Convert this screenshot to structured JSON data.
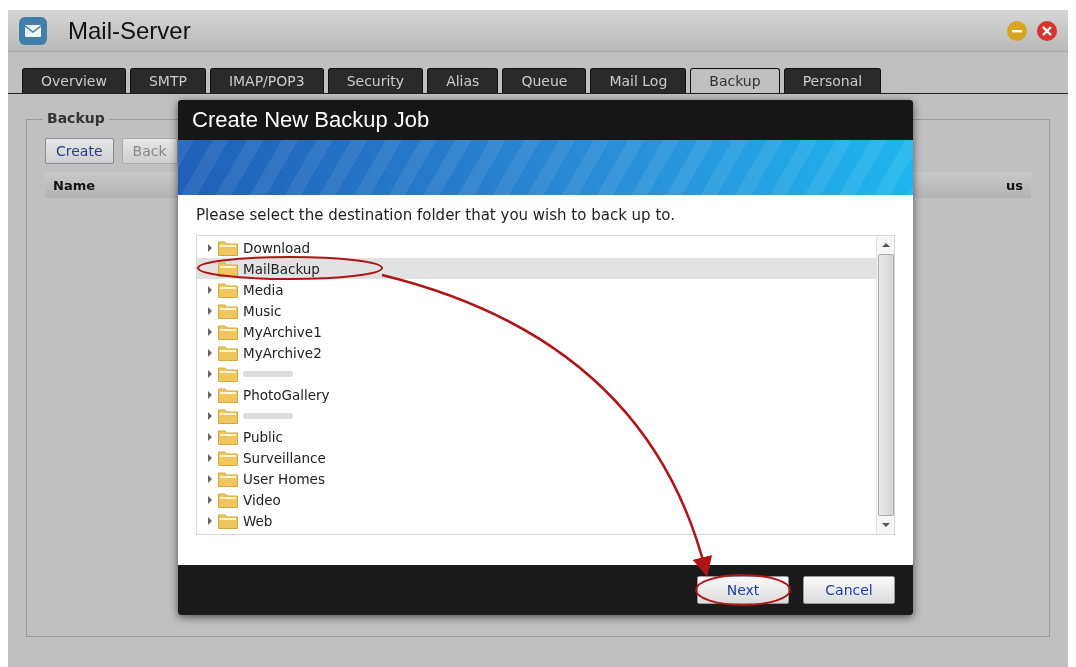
{
  "window": {
    "title": "Mail-Server"
  },
  "tabs": [
    {
      "label": "Overview",
      "selected": false
    },
    {
      "label": "SMTP",
      "selected": false
    },
    {
      "label": "IMAP/POP3",
      "selected": false
    },
    {
      "label": "Security",
      "selected": false
    },
    {
      "label": "Alias",
      "selected": false
    },
    {
      "label": "Queue",
      "selected": false
    },
    {
      "label": "Mail Log",
      "selected": false
    },
    {
      "label": "Backup",
      "selected": true
    },
    {
      "label": "Personal",
      "selected": false
    }
  ],
  "backup_panel": {
    "legend": "Backup",
    "buttons": [
      {
        "label": "Create",
        "disabled": false
      },
      {
        "label": "Back",
        "disabled": true
      }
    ],
    "columns": [
      "Name",
      "us"
    ]
  },
  "dialog": {
    "title": "Create New Backup Job",
    "prompt": "Please select the destination folder that you wish to back up to.",
    "folders": [
      {
        "kind": "folder",
        "label": "Download",
        "has_children": true,
        "selected": false
      },
      {
        "kind": "folder",
        "label": "MailBackup",
        "has_children": false,
        "selected": true
      },
      {
        "kind": "folder",
        "label": "Media",
        "has_children": true,
        "selected": false
      },
      {
        "kind": "folder",
        "label": "Music",
        "has_children": true,
        "selected": false
      },
      {
        "kind": "folder",
        "label": "MyArchive1",
        "has_children": true,
        "selected": false
      },
      {
        "kind": "folder",
        "label": "MyArchive2",
        "has_children": true,
        "selected": false
      },
      {
        "kind": "obscured",
        "has_children": true,
        "selected": false
      },
      {
        "kind": "folder",
        "label": "PhotoGallery",
        "has_children": true,
        "selected": false
      },
      {
        "kind": "obscured",
        "has_children": true,
        "selected": false
      },
      {
        "kind": "folder",
        "label": "Public",
        "has_children": true,
        "selected": false
      },
      {
        "kind": "folder",
        "label": "Surveillance",
        "has_children": true,
        "selected": false
      },
      {
        "kind": "folder",
        "label": "User Homes",
        "has_children": true,
        "selected": false
      },
      {
        "kind": "folder",
        "label": "Video",
        "has_children": true,
        "selected": false
      },
      {
        "kind": "folder",
        "label": "Web",
        "has_children": true,
        "selected": false
      }
    ],
    "buttons": [
      "Next",
      "Cancel"
    ]
  }
}
